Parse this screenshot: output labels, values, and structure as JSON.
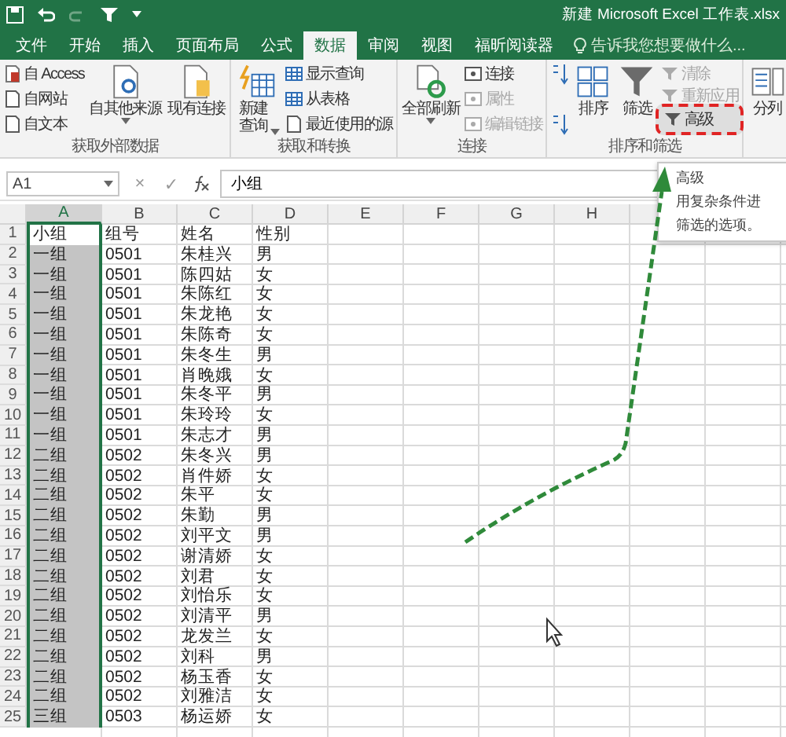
{
  "title_bar": {
    "title": "新建 Microsoft Excel 工作表.xlsx"
  },
  "tabs": [
    {
      "label": "文件",
      "selected": false
    },
    {
      "label": "开始",
      "selected": false
    },
    {
      "label": "插入",
      "selected": false
    },
    {
      "label": "页面布局",
      "selected": false
    },
    {
      "label": "公式",
      "selected": false
    },
    {
      "label": "数据",
      "selected": true
    },
    {
      "label": "审阅",
      "selected": false
    },
    {
      "label": "视图",
      "selected": false
    },
    {
      "label": "福昕阅读器",
      "selected": false
    }
  ],
  "tell_me": {
    "placeholder": "告诉我您想要做什么..."
  },
  "ribbon": {
    "groups": [
      {
        "label": "获取外部数据",
        "items": [
          {
            "kind": "stack",
            "items": [
              {
                "label": "自 Access",
                "disabled": false
              },
              {
                "label": "自网站",
                "disabled": false
              },
              {
                "label": "自文本",
                "disabled": false
              }
            ]
          },
          {
            "kind": "large",
            "label": "自其他来源",
            "has_menu": true
          },
          {
            "kind": "large",
            "label": "现有连接",
            "has_menu": false
          }
        ]
      },
      {
        "label": "获取和转换",
        "items": [
          {
            "kind": "large",
            "label": "新建查询",
            "has_menu": true
          },
          {
            "kind": "stack",
            "items": [
              {
                "label": "显示查询",
                "disabled": false
              },
              {
                "label": "从表格",
                "disabled": false
              },
              {
                "label": "最近使用的源",
                "disabled": false
              }
            ]
          }
        ]
      },
      {
        "label": "连接",
        "items": [
          {
            "kind": "large",
            "label": "全部刷新",
            "has_menu": true
          },
          {
            "kind": "stack",
            "items": [
              {
                "label": "连接",
                "disabled": false
              },
              {
                "label": "属性",
                "disabled": true
              },
              {
                "label": "编辑链接",
                "disabled": true
              }
            ]
          }
        ]
      },
      {
        "label": "排序和筛选",
        "items": [
          {
            "kind": "sort"
          },
          {
            "kind": "large",
            "label": "排序",
            "has_menu": false
          },
          {
            "kind": "large",
            "label": "筛选",
            "has_menu": false
          },
          {
            "kind": "stack",
            "items": [
              {
                "label": "清除",
                "disabled": true,
                "highlighted": false
              },
              {
                "label": "重新应用",
                "disabled": true,
                "highlighted": false
              },
              {
                "label": "高级",
                "disabled": false,
                "highlighted": true
              }
            ]
          }
        ]
      },
      {
        "items": [
          {
            "kind": "large",
            "label": "分列",
            "has_menu": false
          }
        ]
      }
    ]
  },
  "formula_bar": {
    "name_box": "A1",
    "cancel": "×",
    "enter": "✓",
    "value": "小组"
  },
  "tooltip": {
    "title": "高级",
    "lines": [
      "用复杂条件进",
      "筛选的选项。"
    ]
  },
  "columns": [
    {
      "label": "A",
      "selected": true
    },
    {
      "label": "B",
      "selected": false
    },
    {
      "label": "C",
      "selected": false
    },
    {
      "label": "D",
      "selected": false
    },
    {
      "label": "E",
      "selected": false
    },
    {
      "label": "F",
      "selected": false
    },
    {
      "label": "G",
      "selected": false
    },
    {
      "label": "H",
      "selected": false
    }
  ],
  "rows": [
    {
      "number": "1",
      "cells": [
        "小组",
        "组号",
        "姓名",
        "性别"
      ]
    },
    {
      "number": "2",
      "cells": [
        "一组",
        "0501",
        "朱桂兴",
        "男"
      ]
    },
    {
      "number": "3",
      "cells": [
        "一组",
        "0501",
        "陈四姑",
        "女"
      ]
    },
    {
      "number": "4",
      "cells": [
        "一组",
        "0501",
        "朱陈红",
        "女"
      ]
    },
    {
      "number": "5",
      "cells": [
        "一组",
        "0501",
        "朱龙艳",
        "女"
      ]
    },
    {
      "number": "6",
      "cells": [
        "一组",
        "0501",
        "朱陈奇",
        "女"
      ]
    },
    {
      "number": "7",
      "cells": [
        "一组",
        "0501",
        "朱冬生",
        "男"
      ]
    },
    {
      "number": "8",
      "cells": [
        "一组",
        "0501",
        "肖晚娥",
        "女"
      ]
    },
    {
      "number": "9",
      "cells": [
        "一组",
        "0501",
        "朱冬平",
        "男"
      ]
    },
    {
      "number": "10",
      "cells": [
        "一组",
        "0501",
        "朱玲玲",
        "女"
      ]
    },
    {
      "number": "11",
      "cells": [
        "一组",
        "0501",
        "朱志才",
        "男"
      ]
    },
    {
      "number": "12",
      "cells": [
        "二组",
        "0502",
        "朱冬兴",
        "男"
      ]
    },
    {
      "number": "13",
      "cells": [
        "二组",
        "0502",
        "肖件娇",
        "女"
      ]
    },
    {
      "number": "14",
      "cells": [
        "二组",
        "0502",
        "朱平",
        "女"
      ]
    },
    {
      "number": "15",
      "cells": [
        "二组",
        "0502",
        "朱勤",
        "男"
      ]
    },
    {
      "number": "16",
      "cells": [
        "二组",
        "0502",
        "刘平文",
        "男"
      ]
    },
    {
      "number": "17",
      "cells": [
        "二组",
        "0502",
        "谢清娇",
        "女"
      ]
    },
    {
      "number": "18",
      "cells": [
        "二组",
        "0502",
        "刘君",
        "女"
      ]
    },
    {
      "number": "19",
      "cells": [
        "二组",
        "0502",
        "刘怡乐",
        "女"
      ]
    },
    {
      "number": "20",
      "cells": [
        "二组",
        "0502",
        "刘清平",
        "男"
      ]
    },
    {
      "number": "21",
      "cells": [
        "二组",
        "0502",
        "龙发兰",
        "女"
      ]
    },
    {
      "number": "22",
      "cells": [
        "二组",
        "0502",
        "刘科",
        "男"
      ]
    },
    {
      "number": "23",
      "cells": [
        "二组",
        "0502",
        "杨玉香",
        "女"
      ]
    },
    {
      "number": "24",
      "cells": [
        "二组",
        "0502",
        "刘雅洁",
        "女"
      ]
    },
    {
      "number": "25",
      "cells": [
        "三组",
        "0503",
        "杨运娇",
        "女"
      ]
    }
  ]
}
